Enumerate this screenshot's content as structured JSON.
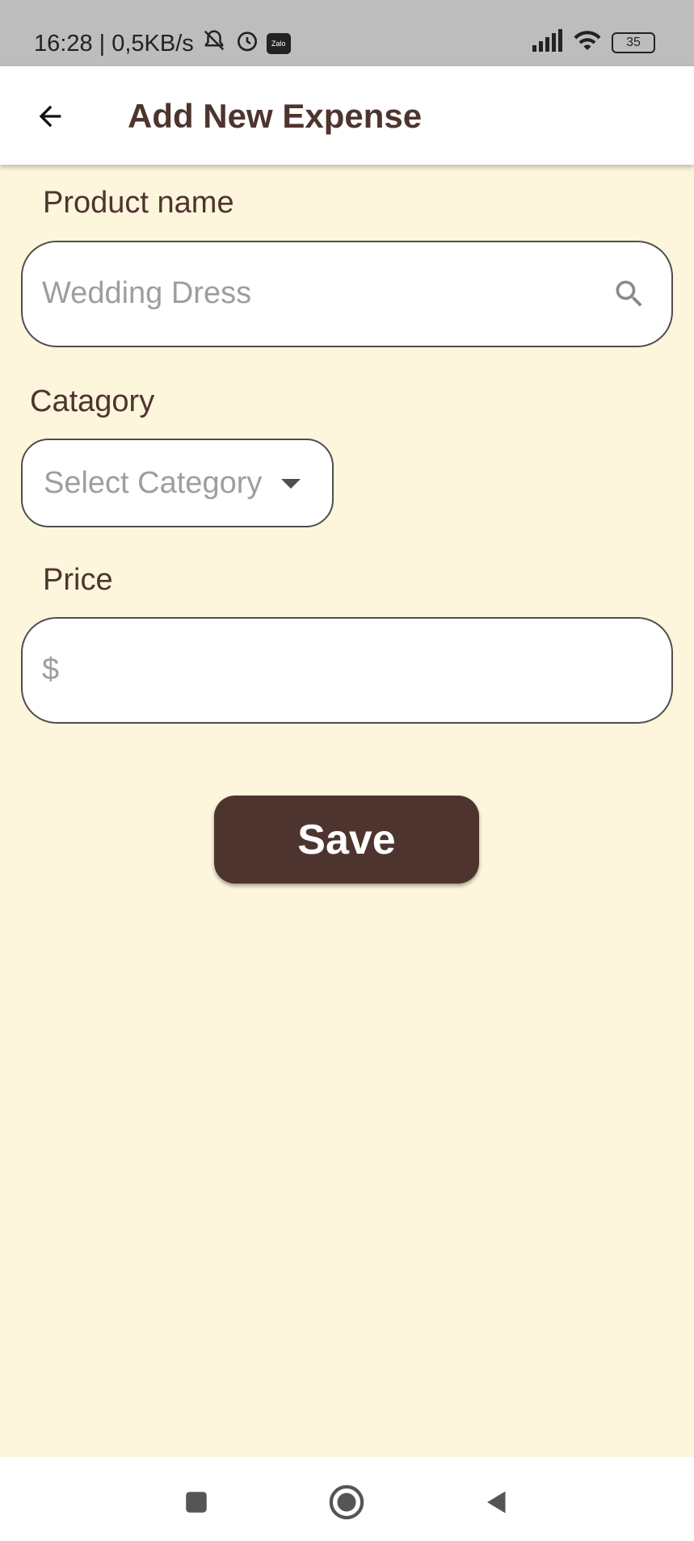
{
  "status_bar": {
    "time_speed": "16:28 | 0,5KB/s",
    "zalo_label": "Zalo",
    "battery": "35"
  },
  "app_bar": {
    "title": "Add New Expense"
  },
  "form": {
    "product_name": {
      "label": "Product name",
      "placeholder": "Wedding Dress"
    },
    "category": {
      "label": "Catagory",
      "placeholder": "Select Category"
    },
    "price": {
      "label": "Price",
      "prefix": "$"
    },
    "save_label": "Save"
  },
  "colors": {
    "background": "#fdf5dc",
    "accent": "#4e342e"
  },
  "icons": [
    "back-arrow-icon",
    "search-icon",
    "chevron-down-icon",
    "nav-recents-icon",
    "nav-home-icon",
    "nav-back-icon"
  ]
}
